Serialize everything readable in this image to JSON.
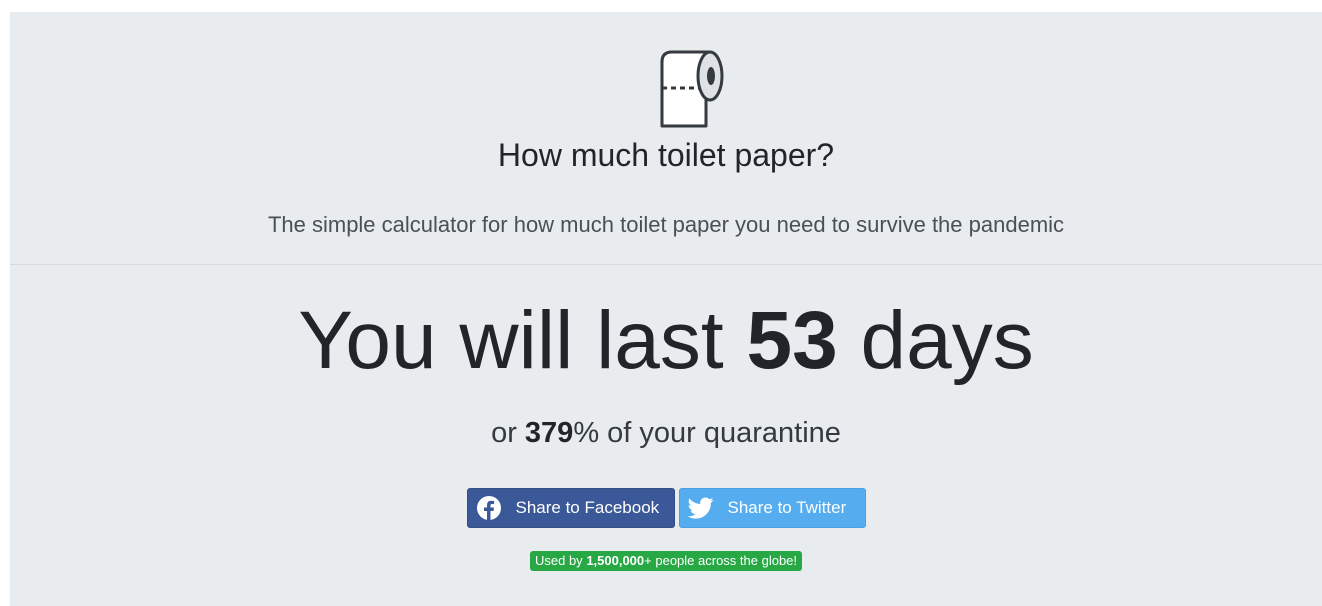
{
  "header": {
    "logo_icon": "toilet-paper-roll-icon",
    "title": "How much toilet paper?",
    "subtitle": "The simple calculator for how much toilet paper you need to survive the pandemic"
  },
  "result": {
    "prefix": "You will last",
    "days": "53",
    "suffix": "days",
    "percent_prefix": "or",
    "percent": "379",
    "percent_suffix": "% of your quarantine"
  },
  "share": {
    "facebook_label": "Share to Facebook",
    "facebook_icon": "facebook-icon",
    "facebook_color": "#3b5998",
    "twitter_label": "Share to Twitter",
    "twitter_icon": "twitter-icon",
    "twitter_color": "#55acee"
  },
  "badge": {
    "prefix": "Used by",
    "count": "1,500,000",
    "suffix": "+ people across the globe!",
    "color": "#28a745"
  }
}
